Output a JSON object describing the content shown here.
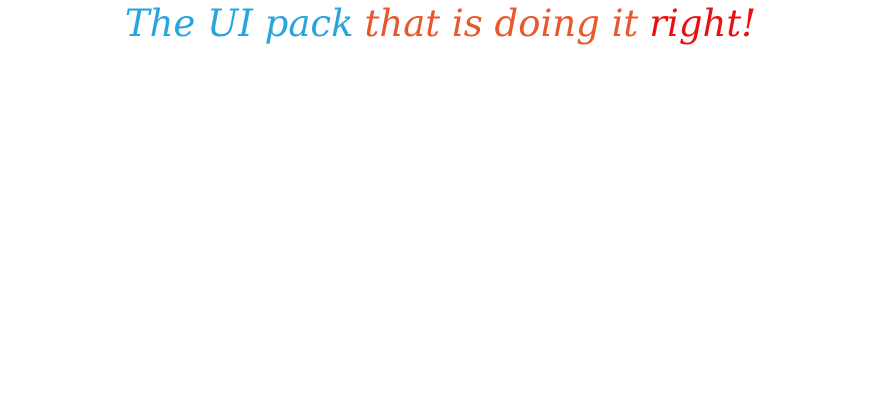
{
  "headline": {
    "part1": "The UI pack",
    "part2": "that is doing it",
    "part3": "right!"
  },
  "colors": {
    "part1": "#2aa4dc",
    "part2": "#e8582c",
    "part3": "#ea1010",
    "background": "#ffffff"
  }
}
